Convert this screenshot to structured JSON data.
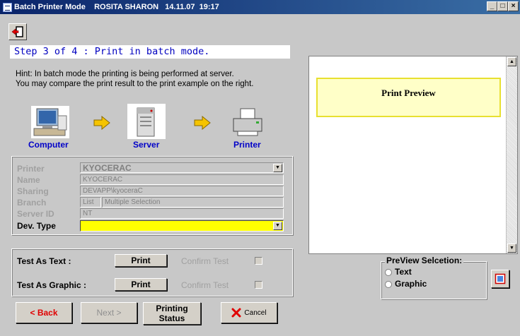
{
  "window": {
    "title": "Batch Printer Mode    ROSITA SHARON   14.11.07  19:17",
    "min": "_",
    "max": "□",
    "close": "×"
  },
  "step_text": "Step 3 of 4 : Print in batch mode.",
  "hint": {
    "line1": "Hint: In batch mode the printing is being performed at server.",
    "line2": "You may compare the print result to the print example on the right."
  },
  "flow": {
    "computer": "Computer",
    "server": "Server",
    "printer": "Printer"
  },
  "printer_box": {
    "printer_label": "Printer",
    "printer_value": "KYOCERAC",
    "name_label": "Name",
    "name_value": "KYOCERAC",
    "sharing_label": "Sharing",
    "sharing_value": "DEVAPP\\kyoceraC",
    "branch_label": "Branch",
    "branch_list": "List",
    "branch_value": "Multiple Selection",
    "server_label": "Server ID",
    "server_value": "NT",
    "devtype_label": "Dev. Type",
    "devtype_value": ""
  },
  "tests": {
    "text_label": "Test As Text :",
    "graphic_label": "Test As Graphic :",
    "print_label": "Print",
    "confirm_label": "Confirm Test"
  },
  "buttons": {
    "back": "< Back",
    "next": "Next >",
    "status_line1": "Printing",
    "status_line2": "Status",
    "cancel": "Cancel"
  },
  "preview": {
    "title": "Print Preview",
    "selection_label": "PreView Selcetion:",
    "opt_text": "Text",
    "opt_graphic": "Graphic"
  },
  "colors": {
    "accent_blue": "#0000c8",
    "devtype_bg": "#ffff00",
    "arrow": "#f5c400"
  }
}
